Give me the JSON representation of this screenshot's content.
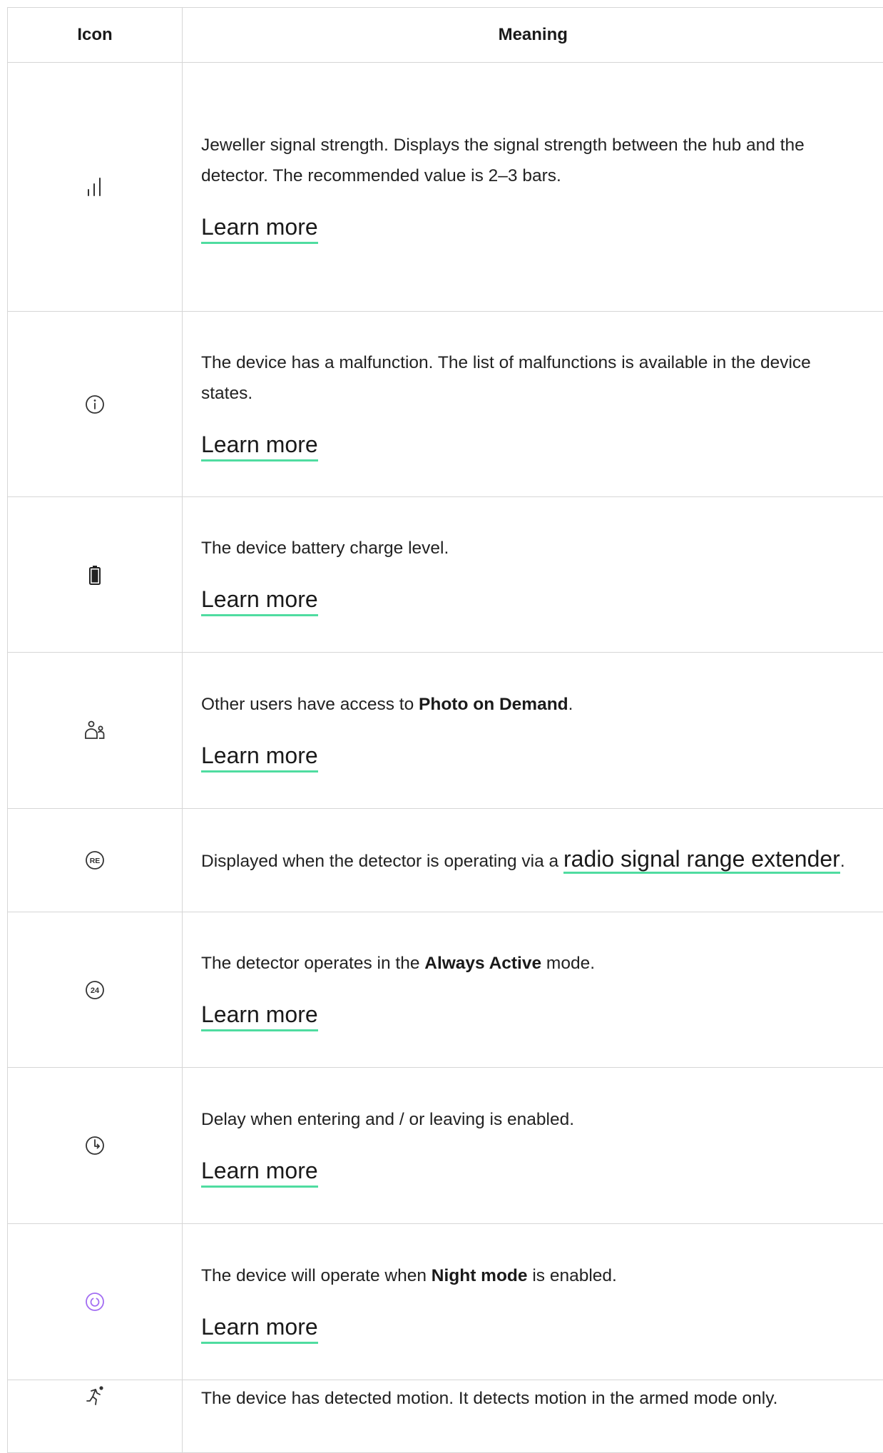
{
  "table": {
    "headers": {
      "icon": "Icon",
      "meaning": "Meaning"
    },
    "learn_more": "Learn more",
    "rows": [
      {
        "icon": "signal-strength-icon",
        "text": "Jeweller signal strength. Displays the signal strength between the hub and the detector. The recommended value is 2–3 bars.",
        "link": "Learn more"
      },
      {
        "icon": "info-circle-icon",
        "text": "The device has a malfunction. The list of malfunctions is available in the device states.",
        "link": "Learn more"
      },
      {
        "icon": "battery-icon",
        "text": "The device battery charge level.",
        "link": "Learn more"
      },
      {
        "icon": "users-icon",
        "text_before": "Other users have access to ",
        "bold": "Photo on Demand",
        "text_after": ".",
        "link": "Learn more"
      },
      {
        "icon": "range-extender-icon",
        "icon_text": "RE",
        "text_before": "Displayed when the detector is operating via a ",
        "inline_link": "radio signal range extender",
        "text_after": "."
      },
      {
        "icon": "always-active-icon",
        "icon_text": "24",
        "text_before": "The detector operates in the ",
        "bold": "Always Active",
        "text_after": " mode.",
        "link": "Learn more"
      },
      {
        "icon": "delay-clock-icon",
        "text": "Delay when entering and / or leaving is enabled.",
        "link": "Learn more"
      },
      {
        "icon": "night-mode-icon",
        "text_before": "The device will operate when ",
        "bold": "Night mode",
        "text_after": " is enabled.",
        "link": "Learn more"
      },
      {
        "icon": "motion-detected-icon",
        "text": "The device has detected motion. It detects motion in the armed mode only."
      }
    ]
  },
  "colors": {
    "link_underline": "#4fdca0",
    "night_mode_icon": "#a26cf2",
    "border": "#d6d6d6"
  }
}
